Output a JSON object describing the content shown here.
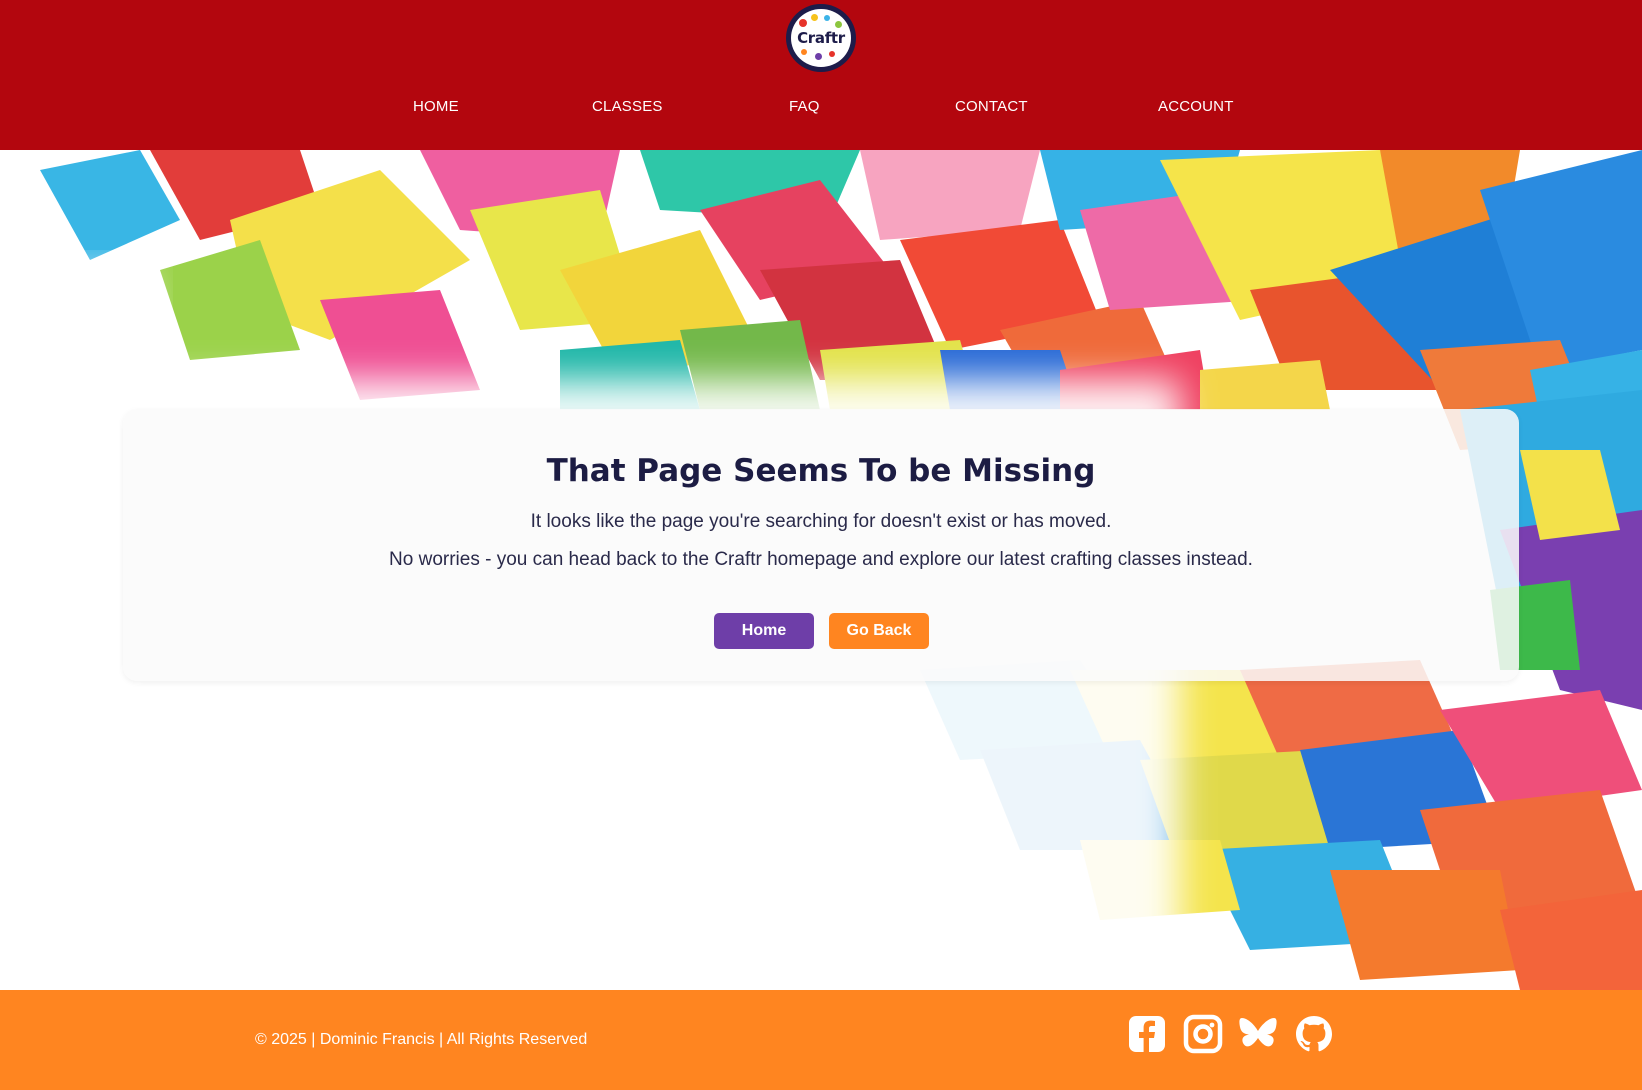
{
  "brand": {
    "logo_text": "Craftr"
  },
  "nav": {
    "items": [
      {
        "label": "HOME"
      },
      {
        "label": "CLASSES"
      },
      {
        "label": "FAQ"
      },
      {
        "label": "CONTACT"
      },
      {
        "label": "ACCOUNT"
      }
    ]
  },
  "error_card": {
    "title": "That Page Seems To be Missing",
    "message_1": "It looks like the page you're searching for doesn't exist or has moved.",
    "message_2": "No worries - you can head back to the Craftr homepage and explore our latest crafting classes instead.",
    "home_button": "Home",
    "back_button": "Go Back"
  },
  "footer": {
    "copyright": "© 2025 | Dominic Francis | All Rights Reserved",
    "social_icons": [
      "facebook-icon",
      "instagram-icon",
      "bluesky-icon",
      "github-icon"
    ]
  },
  "colors": {
    "header_bg": "#b3060e",
    "footer_bg": "#ff8520",
    "primary_button": "#6e3ea8",
    "secondary_button": "#ff8520",
    "title_text": "#1c1c43"
  }
}
